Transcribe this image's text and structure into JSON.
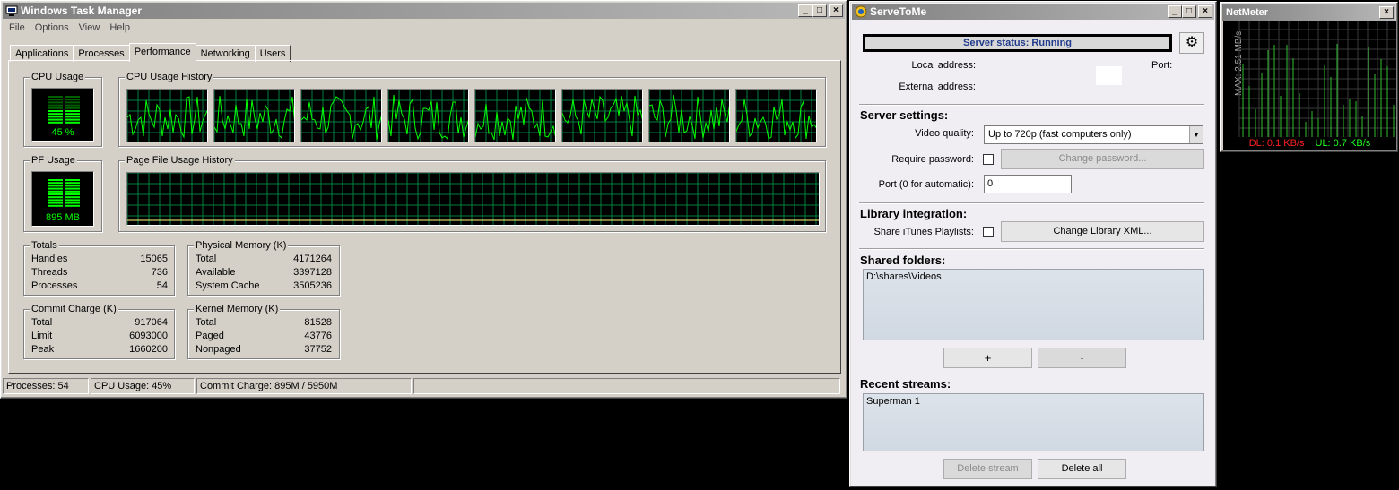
{
  "taskmanager": {
    "title": "Windows Task Manager",
    "menu": [
      "File",
      "Options",
      "View",
      "Help"
    ],
    "tabs": [
      "Applications",
      "Processes",
      "Performance",
      "Networking",
      "Users"
    ],
    "active_tab": "Performance",
    "cpu_usage_label": "CPU Usage",
    "cpu_usage_value": "45 %",
    "cpu_history_label": "CPU Usage History",
    "pf_usage_label": "PF Usage",
    "pf_usage_value": "895 MB",
    "pf_history_label": "Page File Usage History",
    "totals": {
      "label": "Totals",
      "rows": [
        {
          "name": "Handles",
          "value": "15065"
        },
        {
          "name": "Threads",
          "value": "736"
        },
        {
          "name": "Processes",
          "value": "54"
        }
      ]
    },
    "physical_memory": {
      "label": "Physical Memory (K)",
      "rows": [
        {
          "name": "Total",
          "value": "4171264"
        },
        {
          "name": "Available",
          "value": "3397128"
        },
        {
          "name": "System Cache",
          "value": "3505236"
        }
      ]
    },
    "commit_charge": {
      "label": "Commit Charge (K)",
      "rows": [
        {
          "name": "Total",
          "value": "917064"
        },
        {
          "name": "Limit",
          "value": "6093000"
        },
        {
          "name": "Peak",
          "value": "1660200"
        }
      ]
    },
    "kernel_memory": {
      "label": "Kernel Memory (K)",
      "rows": [
        {
          "name": "Total",
          "value": "81528"
        },
        {
          "name": "Paged",
          "value": "43776"
        },
        {
          "name": "Nonpaged",
          "value": "37752"
        }
      ]
    },
    "status": {
      "processes": "Processes: 54",
      "cpu": "CPU Usage: 45%",
      "commit": "Commit Charge: 895M / 5950M"
    }
  },
  "servetome": {
    "title": "ServeToMe",
    "server_status": "Server status: Running",
    "local_address_label": "Local address:",
    "external_address_label": "External address:",
    "port_label": "Port:",
    "server_settings_heading": "Server settings:",
    "video_quality_label": "Video quality:",
    "video_quality_value": "Up to 720p (fast computers only)",
    "require_password_label": "Require password:",
    "change_password_button": "Change password...",
    "port_auto_label": "Port (0 for automatic):",
    "port_value": "0",
    "library_heading": "Library integration:",
    "share_itunes_label": "Share iTunes Playlists:",
    "change_library_button": "Change Library XML...",
    "shared_folders_heading": "Shared folders:",
    "shared_folders": [
      "D:\\shares\\Videos"
    ],
    "add_button": "+",
    "remove_button": "-",
    "recent_streams_heading": "Recent streams:",
    "recent_streams": [
      "Superman 1"
    ],
    "delete_stream_button": "Delete stream",
    "delete_all_button": "Delete all"
  },
  "netmeter": {
    "title": "NetMeter",
    "max_label": "MAX: 2.51 MB/s",
    "dl": "DL: 0.1 KB/s",
    "ul": "UL: 0.7 KB/s",
    "dl_color": "#ff2020",
    "ul_color": "#20ff20"
  },
  "colors": {
    "graph_line": "#00ff00",
    "graph_grid": "#008040",
    "status_text": "#203a8c"
  }
}
